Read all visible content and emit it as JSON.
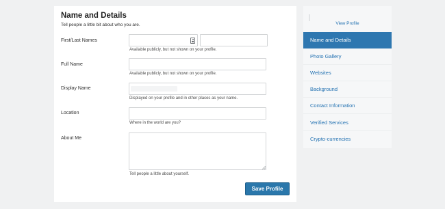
{
  "form": {
    "title": "Name and Details",
    "subtitle": "Tell people a little bit about who you are.",
    "fields": {
      "first_last": {
        "label": "First/Last Names",
        "first_value": "",
        "last_value": "",
        "hint": "Available publicly, but not shown on your profile."
      },
      "full_name": {
        "label": "Full Name",
        "value": "",
        "hint": "Available publicly, but not shown on your profile."
      },
      "display_name": {
        "label": "Display Name",
        "hint": "Displayed on your profile and in other places as your name."
      },
      "location": {
        "label": "Location",
        "value": "",
        "hint": "Where in the world are you?"
      },
      "about_me": {
        "label": "About Me",
        "value": "",
        "hint": "Tell people a little about yourself."
      }
    },
    "save_label": "Save Profile"
  },
  "sidebar": {
    "view_profile": "View Profile",
    "items": [
      {
        "label": "Name and Details",
        "active": true
      },
      {
        "label": "Photo Gallery",
        "active": false
      },
      {
        "label": "Websites",
        "active": false
      },
      {
        "label": "Background",
        "active": false
      },
      {
        "label": "Contact Information",
        "active": false
      },
      {
        "label": "Verified Services",
        "active": false
      },
      {
        "label": "Crypto-currencies",
        "active": false
      }
    ]
  },
  "colors": {
    "background": "#f0f1f2",
    "accent": "#2e77b0",
    "link": "#2271b1",
    "button": "#2a77ab"
  }
}
